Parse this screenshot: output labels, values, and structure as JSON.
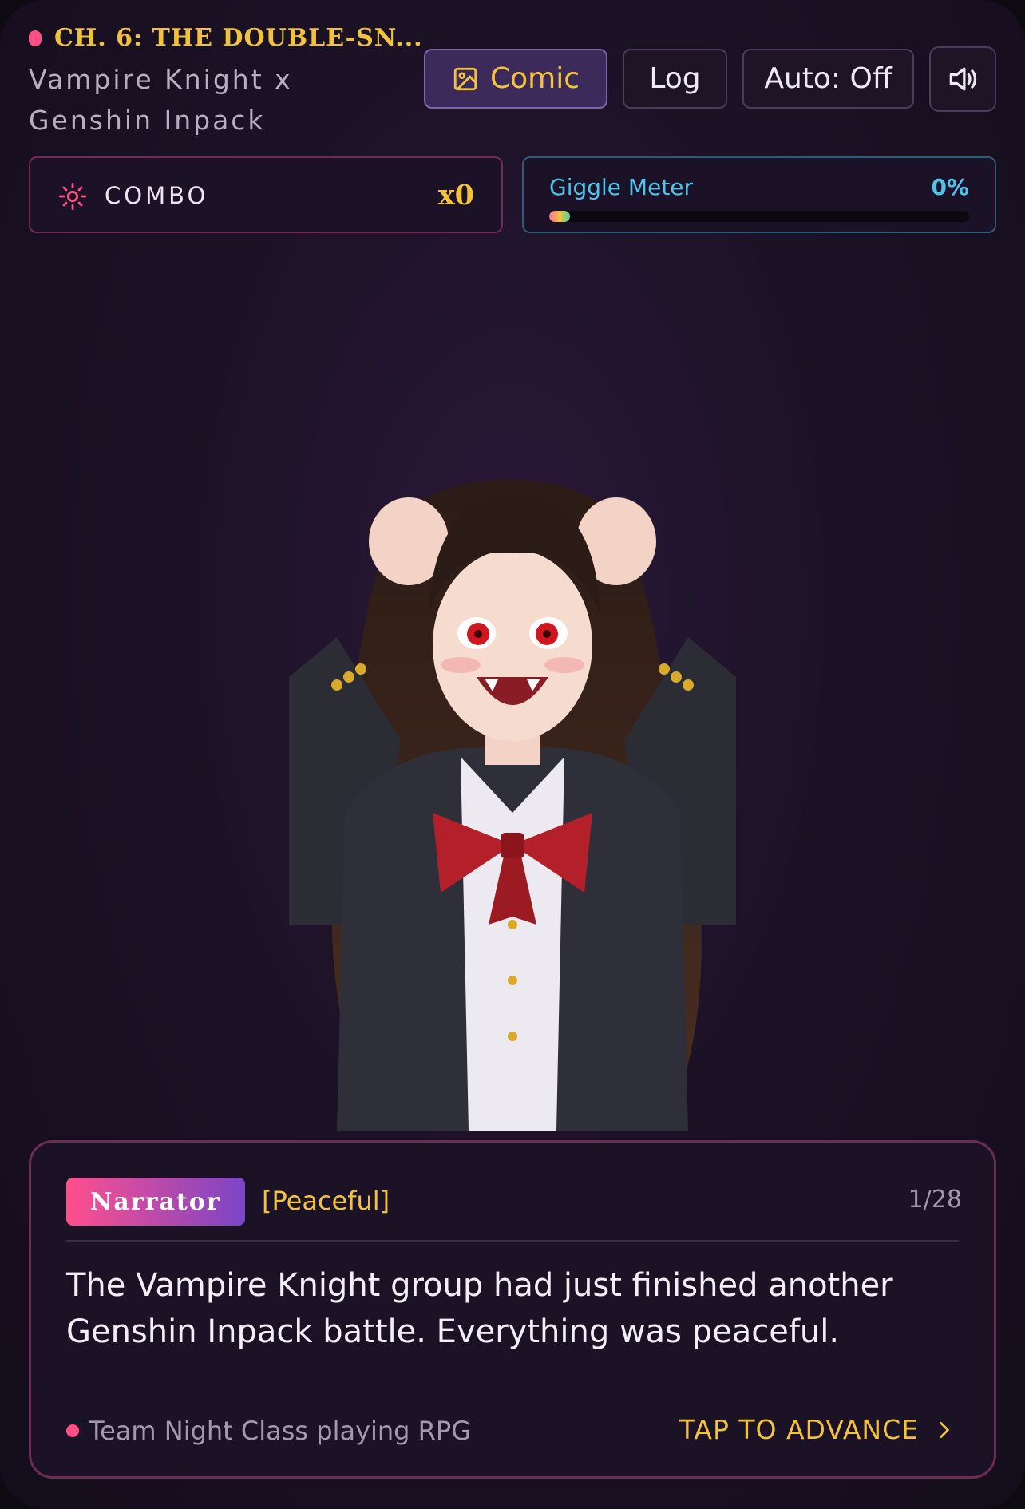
{
  "header": {
    "chapter": "CH. 6: THE DOUBLE-SN...",
    "subtitle": "Vampire Knight x Genshin Inpack"
  },
  "toolbar": {
    "comic_label": "Comic",
    "log_label": "Log",
    "auto_label": "Auto: Off",
    "sound_icon": "speaker-volume-icon",
    "comic_icon": "image-icon"
  },
  "combo": {
    "label": "COMBO",
    "value": "x0"
  },
  "giggle": {
    "label": "Giggle Meter",
    "value": "0%",
    "level": 0.05
  },
  "dialogue": {
    "speaker": "Narrator",
    "mood": "[Peaceful]",
    "counter": "1/28",
    "text": "The Vampire Knight group had just finished another Genshin Inpack battle. Everything was peaceful.",
    "footer": "Team Night Class playing RPG",
    "advance": "TAP TO ADVANCE"
  },
  "colors": {
    "accent": "#f2c23c",
    "pink": "#ff4f86",
    "cyan": "#4fc3ea",
    "background": "#1c1226"
  }
}
